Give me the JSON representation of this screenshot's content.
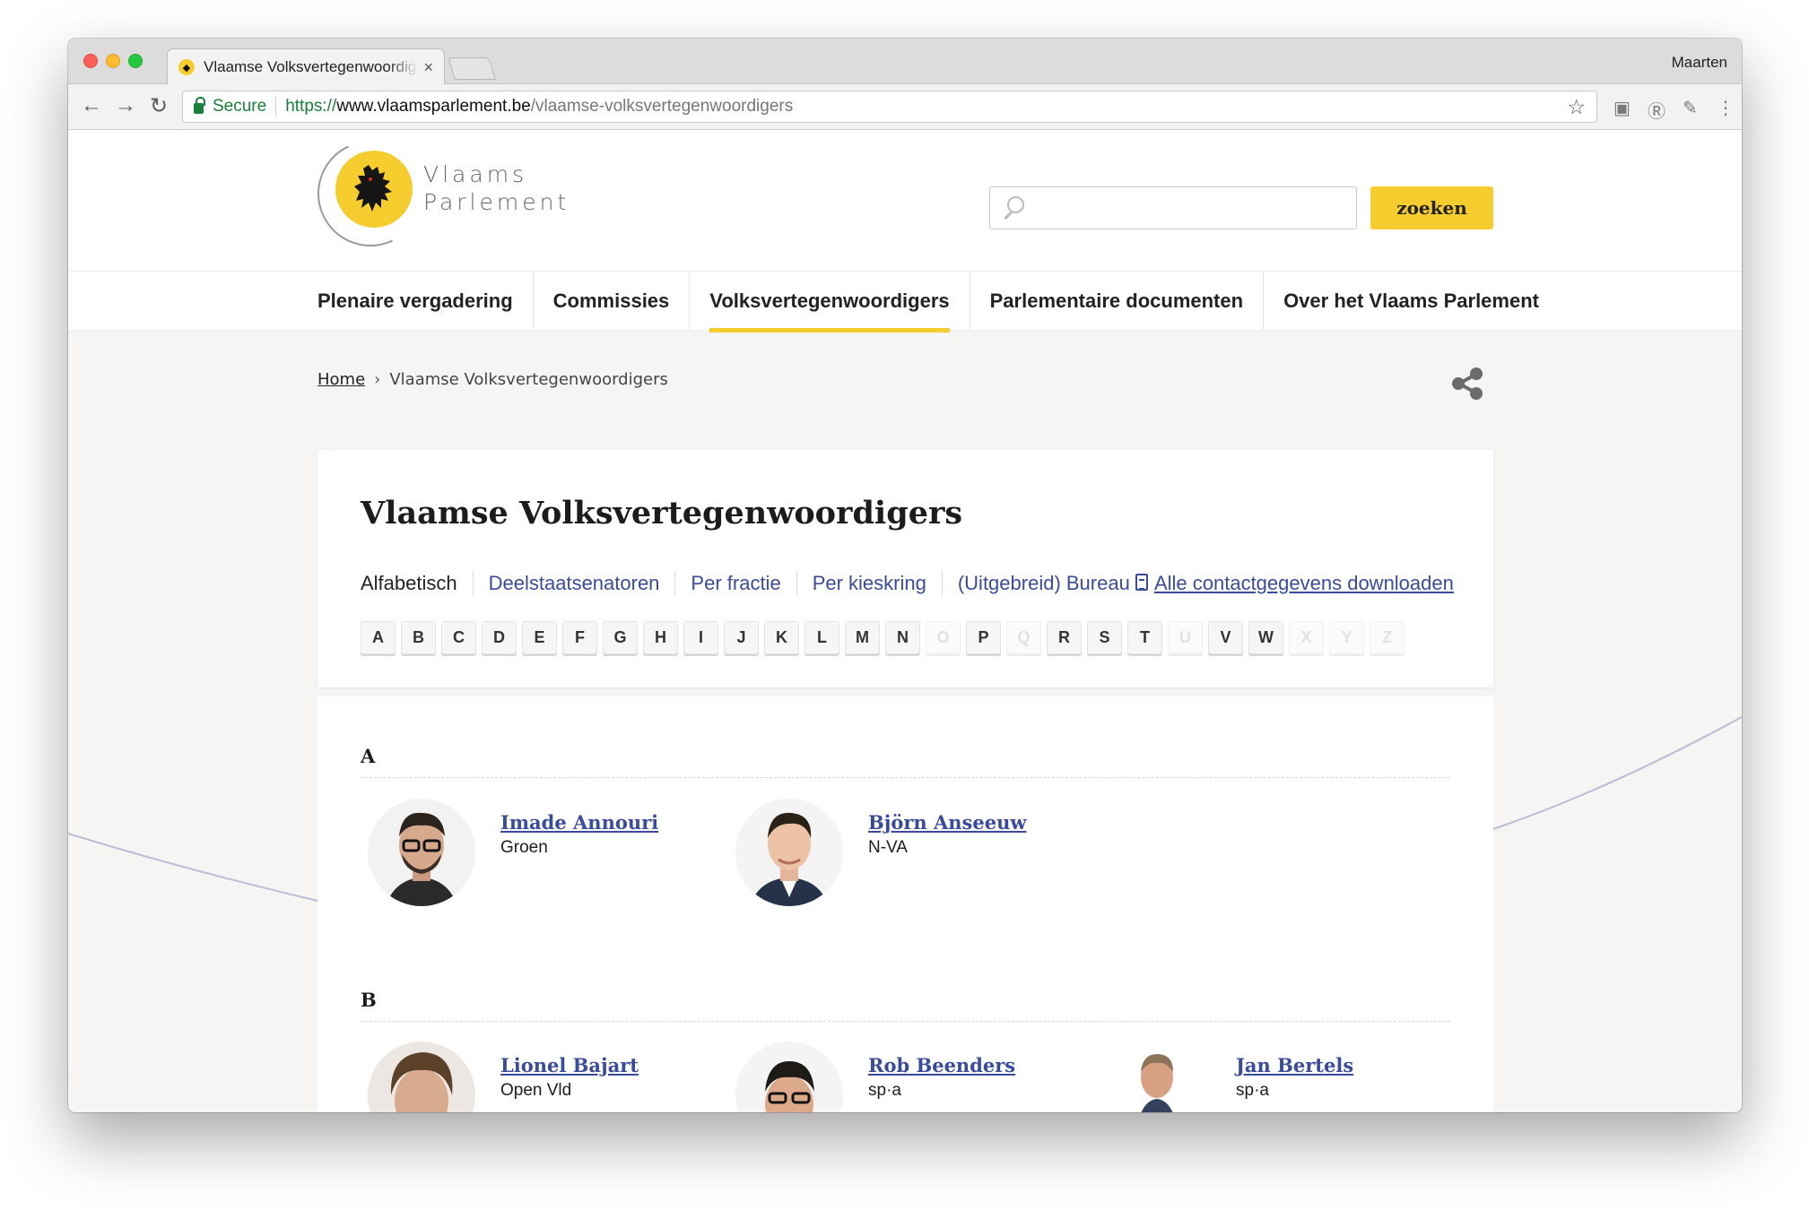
{
  "browser": {
    "tab_title": "Vlaamse Volksvertegenwoordigers",
    "tab_close": "×",
    "profile": "Maarten",
    "secure_label": "Secure",
    "url_scheme": "https://",
    "url_host": "www.vlaamsparlement.be",
    "url_path": "/vlaamse-volksvertegenwoordigers",
    "icons": [
      "back-icon",
      "forward-icon",
      "reload-icon",
      "lock-icon",
      "star-icon",
      "extension-icon",
      "pinterest-icon",
      "eyedropper-icon",
      "menu-icon"
    ]
  },
  "header": {
    "logo_line1": "Vlaams",
    "logo_line2": "Parlement",
    "search_placeholder": "",
    "search_button": "zoeken",
    "accent_color": "#f5cd2e"
  },
  "nav": {
    "items": [
      "Plenaire vergadering",
      "Commissies",
      "Volksvertegenwoordigers",
      "Parlementaire documenten",
      "Over het Vlaams Parlement"
    ],
    "active": "Volksvertegenwoordigers"
  },
  "breadcrumb": {
    "home": "Home",
    "current": "Vlaamse Volksvertegenwoordigers"
  },
  "main": {
    "title": "Vlaamse Volksvertegenwoordigers",
    "subnav": {
      "alfabetisch": "Alfabetisch",
      "deelstaat": "Deelstaatsenatoren",
      "fractie": "Per fractie",
      "kieskring": "Per kieskring",
      "bureau": "(Uitgebreid) Bureau",
      "download": "Alle contactgegevens downloaden"
    },
    "letters": [
      {
        "l": "A",
        "on": true
      },
      {
        "l": "B",
        "on": true
      },
      {
        "l": "C",
        "on": true
      },
      {
        "l": "D",
        "on": true
      },
      {
        "l": "E",
        "on": true
      },
      {
        "l": "F",
        "on": true
      },
      {
        "l": "G",
        "on": true
      },
      {
        "l": "H",
        "on": true
      },
      {
        "l": "I",
        "on": true
      },
      {
        "l": "J",
        "on": true
      },
      {
        "l": "K",
        "on": true
      },
      {
        "l": "L",
        "on": true
      },
      {
        "l": "M",
        "on": true
      },
      {
        "l": "N",
        "on": true
      },
      {
        "l": "O",
        "on": false
      },
      {
        "l": "P",
        "on": true
      },
      {
        "l": "Q",
        "on": false
      },
      {
        "l": "R",
        "on": true
      },
      {
        "l": "S",
        "on": true
      },
      {
        "l": "T",
        "on": true
      },
      {
        "l": "U",
        "on": false
      },
      {
        "l": "V",
        "on": true
      },
      {
        "l": "W",
        "on": true
      },
      {
        "l": "X",
        "on": false
      },
      {
        "l": "Y",
        "on": false
      },
      {
        "l": "Z",
        "on": false
      }
    ]
  },
  "sections": [
    {
      "letter": "A",
      "members": [
        {
          "name": "Imade Annouri",
          "party": "Groen"
        },
        {
          "name": "Björn Anseeuw",
          "party": "N-VA"
        }
      ]
    },
    {
      "letter": "B",
      "members": [
        {
          "name": "Lionel Bajart",
          "party": "Open Vld"
        },
        {
          "name": "Rob Beenders",
          "party": "sp·a"
        },
        {
          "name": "Jan Bertels",
          "party": "sp·a"
        }
      ]
    }
  ]
}
